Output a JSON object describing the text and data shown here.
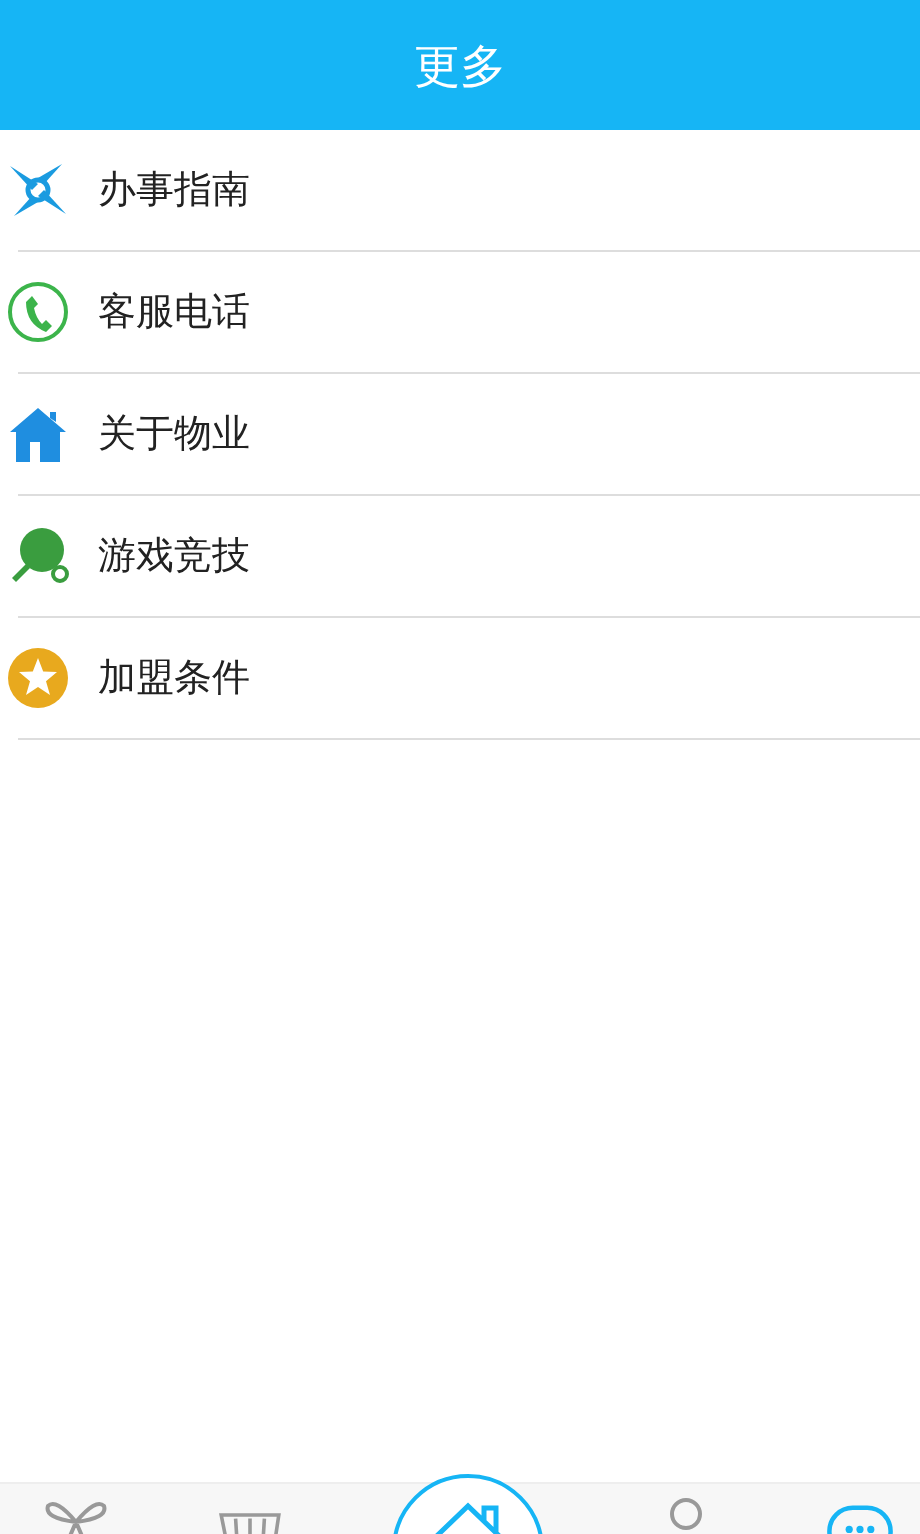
{
  "header": {
    "title": "更多"
  },
  "menu": [
    {
      "kind": "compass",
      "label": "办事指南"
    },
    {
      "kind": "phone",
      "label": "客服电话"
    },
    {
      "kind": "house",
      "label": "关于物业"
    },
    {
      "kind": "paddle",
      "label": "游戏竞技"
    },
    {
      "kind": "star",
      "label": "加盟条件"
    }
  ],
  "tab_bar": [
    {
      "kind": "gift"
    },
    {
      "kind": "basket"
    },
    {
      "kind": "home"
    },
    {
      "kind": "person"
    },
    {
      "kind": "chat"
    }
  ]
}
